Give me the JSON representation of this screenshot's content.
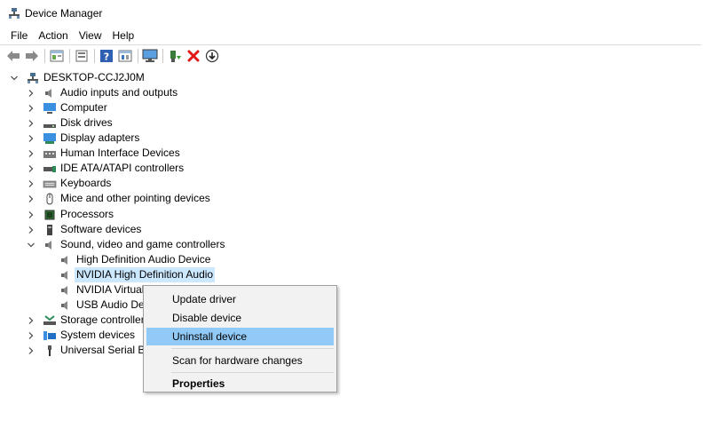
{
  "window": {
    "title": "Device Manager"
  },
  "menu": [
    "File",
    "Action",
    "View",
    "Help"
  ],
  "toolbar": [
    "back-icon",
    "forward-icon",
    "properties-icon",
    "view-icon",
    "help-icon",
    "view-list-icon",
    "monitor-icon",
    "update-driver-icon",
    "uninstall-icon",
    "download-icon"
  ],
  "tree": {
    "root": "DESKTOP-CCJ2J0M",
    "categories": [
      "Audio inputs and outputs",
      "Computer",
      "Disk drives",
      "Display adapters",
      "Human Interface Devices",
      "IDE ATA/ATAPI controllers",
      "Keyboards",
      "Mice and other pointing devices",
      "Processors",
      "Software devices",
      "Sound, video and game controllers"
    ],
    "sound_children": [
      "High Definition Audio Device",
      "NVIDIA High Definition Audio",
      "NVIDIA Virtual A",
      "USB Audio Devi"
    ],
    "after": [
      "Storage controllers",
      "System devices",
      "Universal Serial Bus"
    ]
  },
  "context_menu": {
    "items": [
      "Update driver",
      "Disable device",
      "Uninstall device",
      "Scan for hardware changes",
      "Properties"
    ]
  },
  "colors": {
    "selection": "#cce8ff",
    "menu_highlight": "#91c9f7",
    "menu_bg": "#f2f2f2"
  }
}
